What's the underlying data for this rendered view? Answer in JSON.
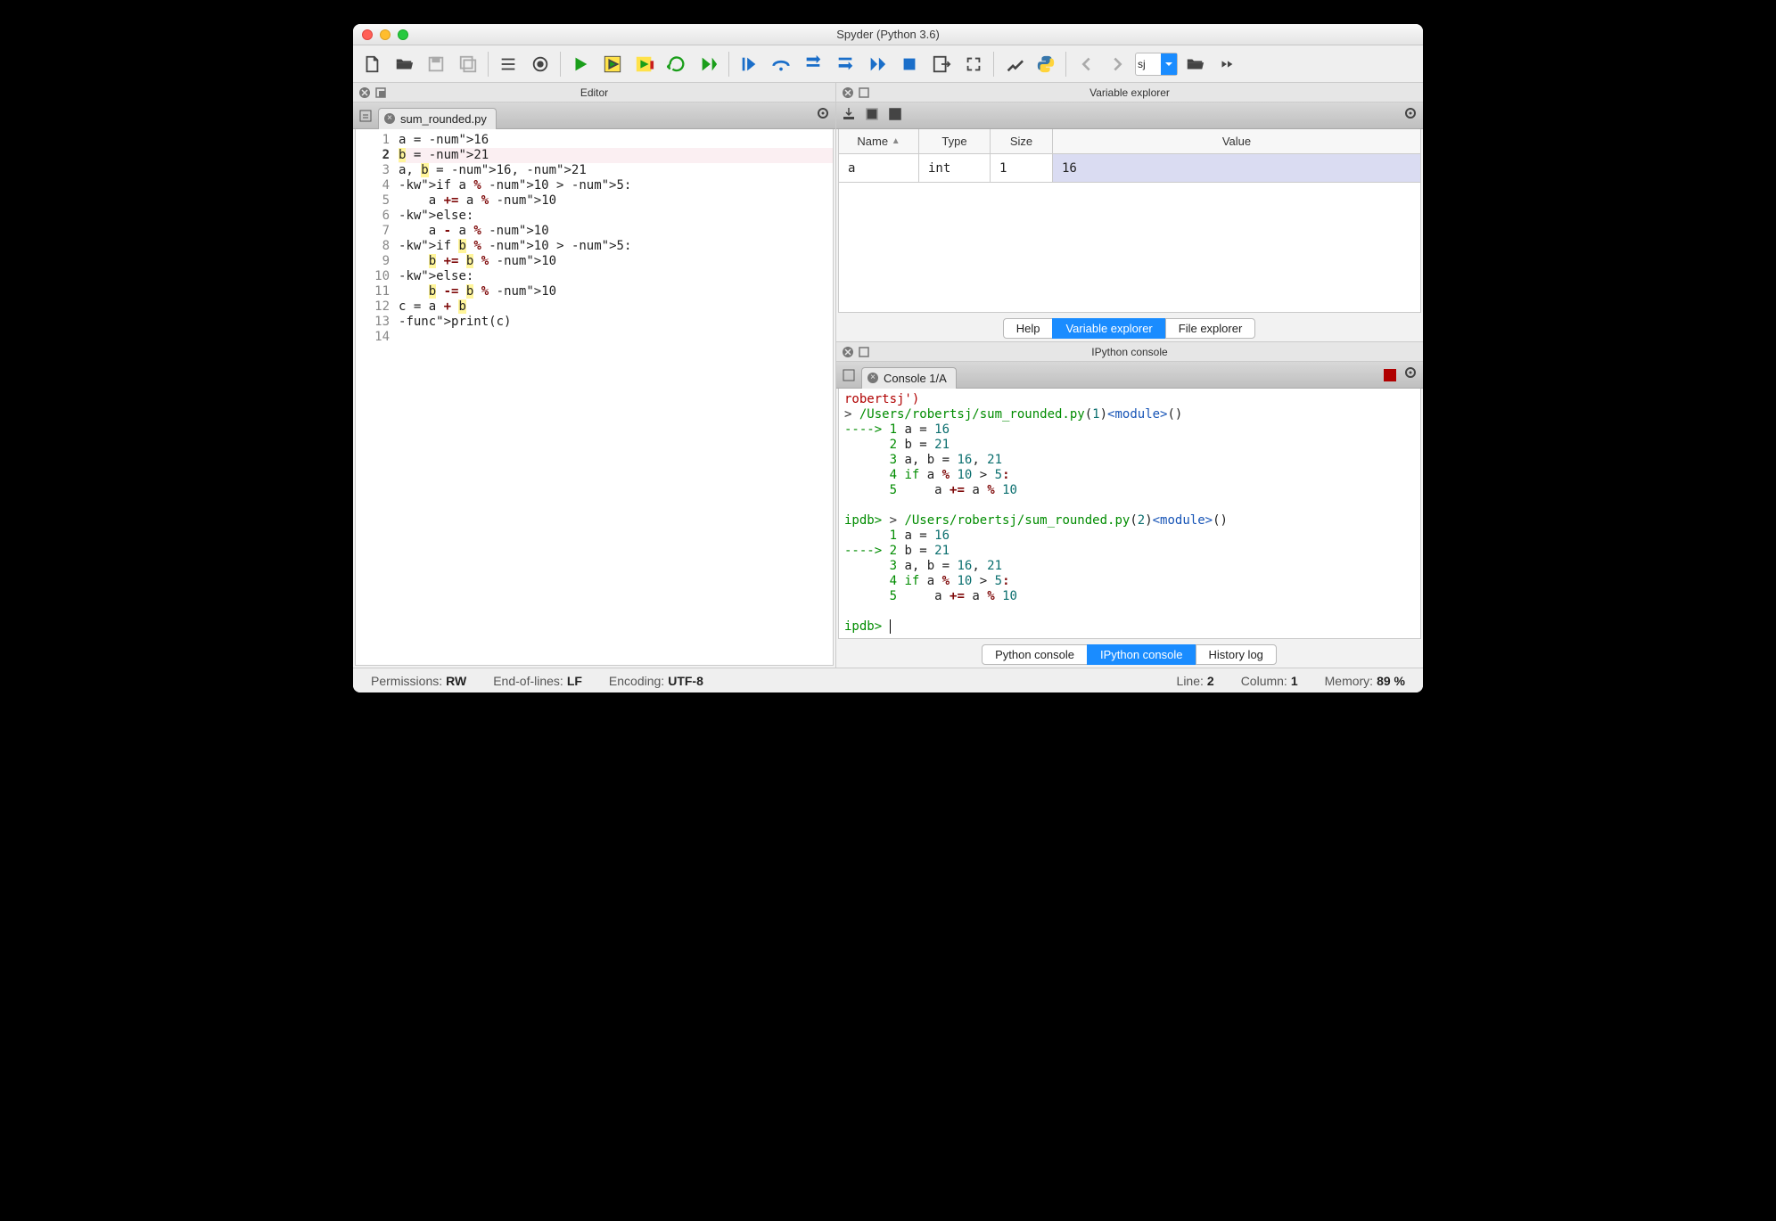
{
  "window": {
    "title": "Spyder (Python 3.6)"
  },
  "toolbar": {
    "project_selected": "sj"
  },
  "editor": {
    "pane_title": "Editor",
    "tab": "sum_rounded.py",
    "highlighted_line": 2,
    "lines": [
      {
        "n": 1,
        "raw": "a = 16"
      },
      {
        "n": 2,
        "raw": "b = 21"
      },
      {
        "n": 3,
        "raw": "a, b = 16, 21"
      },
      {
        "n": 4,
        "raw": "if a % 10 > 5:"
      },
      {
        "n": 5,
        "raw": "    a += a % 10"
      },
      {
        "n": 6,
        "raw": "else:"
      },
      {
        "n": 7,
        "raw": "    a - a % 10"
      },
      {
        "n": 8,
        "raw": "if b % 10 > 5:"
      },
      {
        "n": 9,
        "raw": "    b += b % 10"
      },
      {
        "n": 10,
        "raw": "else:"
      },
      {
        "n": 11,
        "raw": "    b -= b % 10"
      },
      {
        "n": 12,
        "raw": "c = a + b"
      },
      {
        "n": 13,
        "raw": "print(c)"
      },
      {
        "n": 14,
        "raw": ""
      }
    ]
  },
  "var_explorer": {
    "pane_title": "Variable explorer",
    "columns": [
      "Name",
      "Type",
      "Size",
      "Value"
    ],
    "rows": [
      {
        "name": "a",
        "type": "int",
        "size": "1",
        "value": "16"
      }
    ],
    "tabs": [
      "Help",
      "Variable explorer",
      "File explorer"
    ],
    "active_tab": 1
  },
  "ipython": {
    "pane_title": "IPython console",
    "tab": "Console 1/A",
    "tabs": [
      "Python console",
      "IPython console",
      "History log"
    ],
    "active_tab": 1,
    "lines": [
      {
        "type": "red",
        "text": "robertsj')"
      },
      {
        "type": "trace",
        "text": "> /Users/robertsj/sum_rounded.py(1)<module>()"
      },
      {
        "type": "arrow",
        "n": 1,
        "code": "a = 16"
      },
      {
        "type": "plain",
        "n": 2,
        "code": "b = 21"
      },
      {
        "type": "plain",
        "n": 3,
        "code": "a, b = 16, 21"
      },
      {
        "type": "plain",
        "n": 4,
        "code": "if a % 10 > 5:"
      },
      {
        "type": "plain",
        "n": 5,
        "code": "    a += a % 10"
      },
      {
        "type": "blank"
      },
      {
        "type": "ipdb_trace",
        "text": "ipdb> > /Users/robertsj/sum_rounded.py(2)<module>()"
      },
      {
        "type": "plain",
        "n": 1,
        "code": "a = 16"
      },
      {
        "type": "arrow",
        "n": 2,
        "code": "b = 21"
      },
      {
        "type": "plain",
        "n": 3,
        "code": "a, b = 16, 21"
      },
      {
        "type": "plain",
        "n": 4,
        "code": "if a % 10 > 5:"
      },
      {
        "type": "plain",
        "n": 5,
        "code": "    a += a % 10"
      },
      {
        "type": "blank"
      },
      {
        "type": "prompt",
        "text": "ipdb> "
      }
    ]
  },
  "statusbar": {
    "permissions_label": "Permissions:",
    "permissions": "RW",
    "eol_label": "End-of-lines:",
    "eol": "LF",
    "encoding_label": "Encoding:",
    "encoding": "UTF-8",
    "line_label": "Line:",
    "line": "2",
    "column_label": "Column:",
    "column": "1",
    "memory_label": "Memory:",
    "memory": "89 %"
  }
}
